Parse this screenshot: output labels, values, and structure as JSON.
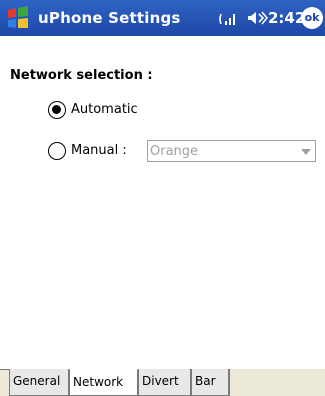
{
  "titlebar": {
    "title": "uPhone Settings",
    "time": "2:42",
    "ok_label": "ok",
    "icons": [
      "windows-start-icon",
      "signal-icon",
      "speaker-icon"
    ]
  },
  "network": {
    "section_title": "Network selection :",
    "automatic_label": "Automatic",
    "manual_label": "Manual :",
    "selected": "Automatic",
    "operator_value": "Orange"
  },
  "tabs": [
    {
      "label": "General"
    },
    {
      "label": "Network"
    },
    {
      "label": "Divert"
    },
    {
      "label": "Bar"
    }
  ],
  "active_tab": "Network",
  "colors": {
    "titlebar": "#1d48a7",
    "disabled_text": "#a0a0a0",
    "tabstrip": "#ece9d8"
  }
}
